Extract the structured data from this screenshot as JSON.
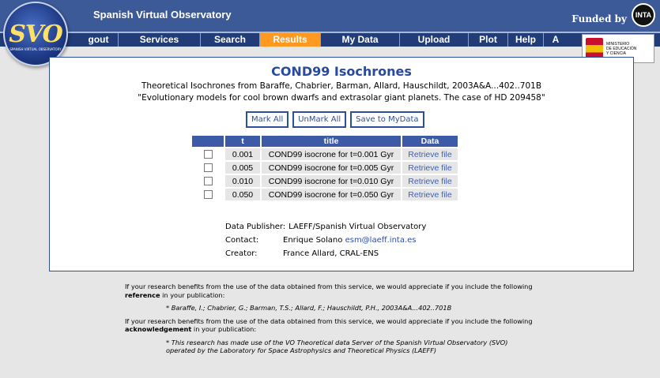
{
  "header": {
    "site_title": "Spanish Virtual Observatory",
    "funded_by": "Funded by",
    "inta_logo": "INTA"
  },
  "logo": {
    "svo_text": "SVO",
    "svo_sub": "SPANISH VIRTUAL OBSERVATORY",
    "ministerio_text_1": "MINISTERIO",
    "ministerio_text_2": "DE EDUCACIÓN",
    "ministerio_text_3": "Y CIENCIA"
  },
  "nav": {
    "items": [
      {
        "label": "gout"
      },
      {
        "label": "Services"
      },
      {
        "label": "Search"
      },
      {
        "label": "Results"
      },
      {
        "label": "My Data"
      },
      {
        "label": "Upload"
      },
      {
        "label": "Plot"
      },
      {
        "label": "Help"
      },
      {
        "label": "A"
      }
    ],
    "active": "Results"
  },
  "main": {
    "title": "COND99 Isochrones",
    "subtitle1": "Theoretical Isochrones from Baraffe, Chabrier, Barman, Allard, Hauschildt, 2003A&A...402..701B",
    "subtitle2": "\"Evolutionary models for cool brown dwarfs and extrasolar giant planets. The case of HD 209458\"",
    "buttons": {
      "mark_all": "Mark All",
      "unmark_all": "UnMark All",
      "save": "Save to MyData"
    },
    "table": {
      "headers": [
        "",
        "t",
        "title",
        "Data"
      ],
      "rows": [
        {
          "t": "0.001",
          "title": "COND99 isocrone for t=0.001 Gyr",
          "data": "Retrieve file"
        },
        {
          "t": "0.005",
          "title": "COND99 isocrone for t=0.005 Gyr",
          "data": "Retrieve file"
        },
        {
          "t": "0.010",
          "title": "COND99 isocrone for t=0.010 Gyr",
          "data": "Retrieve file"
        },
        {
          "t": "0.050",
          "title": "COND99 isocrone for t=0.050 Gyr",
          "data": "Retrieve file"
        }
      ]
    },
    "meta": {
      "publisher_label": "Data Publisher:",
      "publisher_value": "LAEFF/Spanish Virtual Observatory",
      "contact_label": "Contact:",
      "contact_name": "Enrique Solano",
      "contact_email": "esm@laeff.inta.es",
      "creator_label": "Creator:",
      "creator_value": "France Allard, CRAL-ENS"
    }
  },
  "footer": {
    "p1_a": "If your research benefits from the use of the data obtained from this service, we would appreciate if you include the following ",
    "p1_bold": "reference",
    "p1_b": " in your publication:",
    "reference": "* Baraffe, I.; Chabrier, G.; Barman, T.S.; Allard, F.; Hauschildt, P.H., 2003A&A...402..701B",
    "p2_a": "If your research benefits from the use of the data obtained from this service, we would appreciate if you include the following ",
    "p2_bold": "acknowledgement",
    "p2_b": " in your publication:",
    "acknowledgement": "* This research has made use of the VO Theoretical data Server of the Spanish Virtual Observatory (SVO) operated by the Laboratory for Space Astrophysics and Theoretical Physics (LAEFF)"
  },
  "colors": {
    "header_bg": "#3c5a98",
    "nav_bg": "#223c78",
    "nav_active": "#ff9922",
    "title": "#2a4aa0",
    "table_header": "#3c5aa6",
    "link": "#3f5fb0"
  }
}
